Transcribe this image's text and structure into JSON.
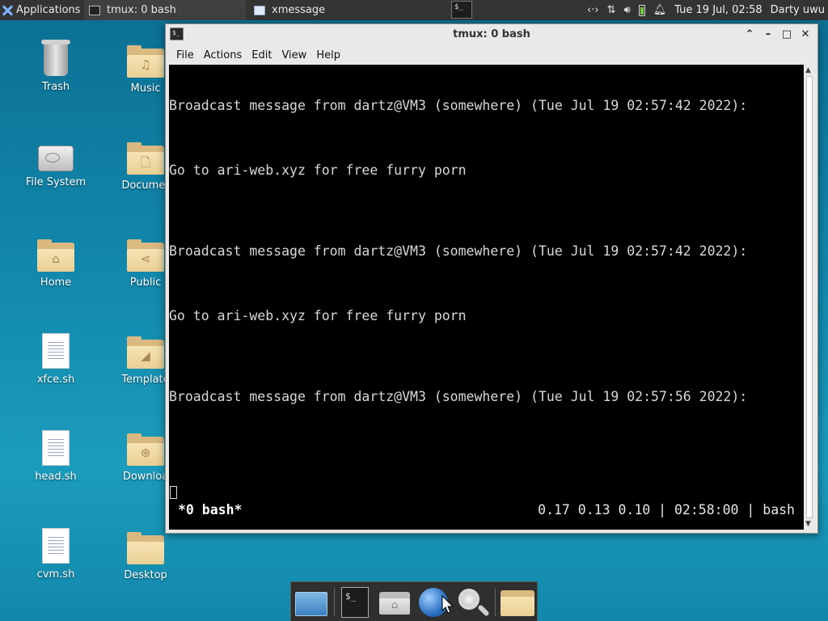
{
  "panel": {
    "applications_label": "Applications",
    "tasks": [
      {
        "label": "tmux: 0 bash"
      },
      {
        "label": "xmessage"
      }
    ],
    "tray_icons": [
      "network-arrows-icon",
      "transfer-icon",
      "volume-icon",
      "battery-icon",
      "notification-bell-icon"
    ],
    "clock": "Tue 19 Jul, 02:58",
    "user": "Darty uwu"
  },
  "desktop_icons": [
    {
      "label": "Trash",
      "icon": "trash-icon"
    },
    {
      "label": "Music",
      "icon": "music-folder-icon"
    },
    {
      "label": "File System",
      "icon": "drive-icon"
    },
    {
      "label": "Documer",
      "icon": "documents-folder-icon"
    },
    {
      "label": "Home",
      "icon": "home-folder-icon"
    },
    {
      "label": "Public",
      "icon": "public-folder-icon"
    },
    {
      "label": "xfce.sh",
      "icon": "script-file-icon"
    },
    {
      "label": "Template",
      "icon": "templates-folder-icon"
    },
    {
      "label": "head.sh",
      "icon": "script-file-icon"
    },
    {
      "label": "Downloa",
      "icon": "downloads-folder-icon"
    },
    {
      "label": "cvm.sh",
      "icon": "script-file-icon"
    },
    {
      "label": "Desktop",
      "icon": "folder-icon"
    }
  ],
  "window": {
    "title": "tmux: 0 bash",
    "menu": [
      "File",
      "Actions",
      "Edit",
      "View",
      "Help"
    ],
    "terminal_lines": [
      "Broadcast message from dartz@VM3 (somewhere) (Tue Jul 19 02:57:42 2022):",
      "Go to ari-web.xyz for free furry porn",
      "Broadcast message from dartz@VM3 (somewhere) (Tue Jul 19 02:57:42 2022):",
      "Go to ari-web.xyz for free furry porn",
      "Broadcast message from dartz@VM3 (somewhere) (Tue Jul 19 02:57:56 2022):"
    ],
    "status_left": "*0 bash*",
    "status_right": "0.17 0.13 0.10 | 02:58:00 | bash"
  },
  "colors": {
    "desktop": "#1289ad",
    "panel": "#343434",
    "terminal_bg": "#000000",
    "terminal_fg": "#d8d8d8"
  }
}
